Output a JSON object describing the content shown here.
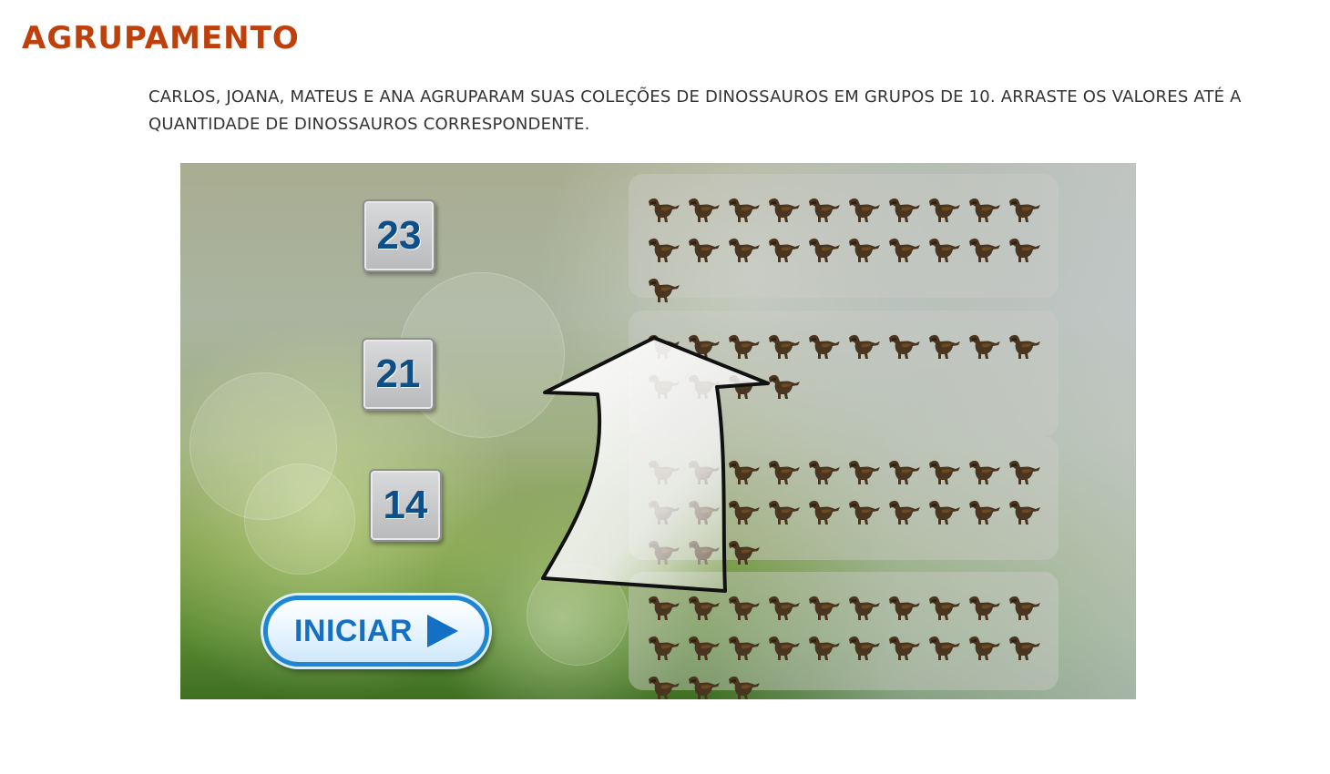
{
  "page": {
    "title": "AGRUPAMENTO",
    "instructions": "CARLOS, JOANA, MATEUS E ANA AGRUPARAM SUAS COLEÇÕES DE DINOSSAUROS EM GRUPOS DE 10. ARRASTE OS VALORES ATÉ A QUANTIDADE DE DINOSSAUROS CORRESPONDENTE."
  },
  "game": {
    "value_tiles": [
      "23",
      "21",
      "14"
    ],
    "dino_groups": [
      21,
      14,
      23,
      23
    ],
    "start_button_label": "INICIAR",
    "colors": {
      "title": "#c0400b",
      "tile_text": "#0d4f86",
      "button_blue": "#1470c4"
    }
  }
}
